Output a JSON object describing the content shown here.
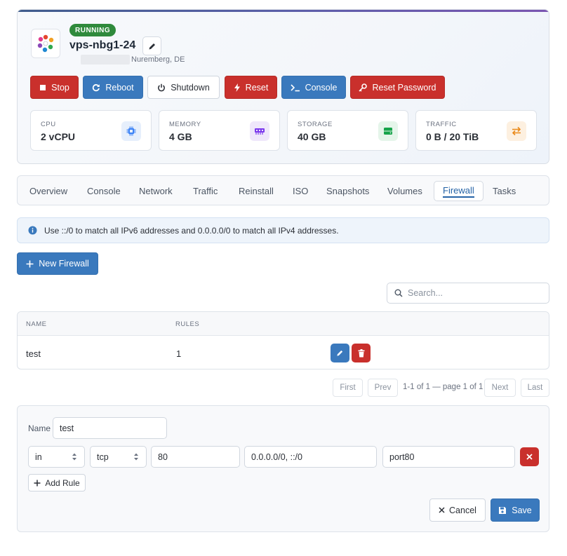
{
  "server": {
    "status": "RUNNING",
    "name": "vps-nbg1-24",
    "location": "Nuremberg, DE"
  },
  "actions": {
    "stop": "Stop",
    "reboot": "Reboot",
    "shutdown": "Shutdown",
    "reset": "Reset",
    "console": "Console",
    "reset_password": "Reset Password"
  },
  "stats": [
    {
      "label": "CPU",
      "value": "2 vCPU",
      "icon": "cpu-icon",
      "color": "#3b82f6"
    },
    {
      "label": "MEMORY",
      "value": "4 GB",
      "icon": "memory-icon",
      "color": "#7c3aed"
    },
    {
      "label": "STORAGE",
      "value": "40 GB",
      "icon": "storage-icon",
      "color": "#16a34a"
    },
    {
      "label": "TRAFFIC",
      "value": "0 B / 20 TiB",
      "icon": "traffic-icon",
      "color": "#ea8a1a"
    }
  ],
  "tabs": [
    "Overview",
    "Console",
    "Network",
    "Traffic",
    "Reinstall",
    "ISO",
    "Snapshots",
    "Volumes",
    "Firewall",
    "Tasks"
  ],
  "active_tab": "Firewall",
  "info_text": "Use ::/0 to match all IPv6 addresses and 0.0.0.0/0 to match all IPv4 addresses.",
  "new_firewall": "New Firewall",
  "search_placeholder": "Search...",
  "table": {
    "columns": [
      "NAME",
      "RULES"
    ],
    "rows": [
      {
        "name": "test",
        "rules": "1"
      }
    ]
  },
  "pagination": {
    "first": "First",
    "prev": "Prev",
    "info": "1-1 of 1 — page 1 of 1",
    "next": "Next",
    "last": "Last"
  },
  "editor": {
    "name_label": "Name",
    "name_value": "test",
    "rule": {
      "direction": "in",
      "protocol": "tcp",
      "port": "80",
      "sources": "0.0.0.0/0, ::/0",
      "description": "port80"
    },
    "add_rule": "Add Rule",
    "cancel": "Cancel",
    "save": "Save"
  },
  "colors": {
    "running": "#2f8a3c",
    "danger": "#c9302c",
    "primary": "#3a79bd"
  }
}
